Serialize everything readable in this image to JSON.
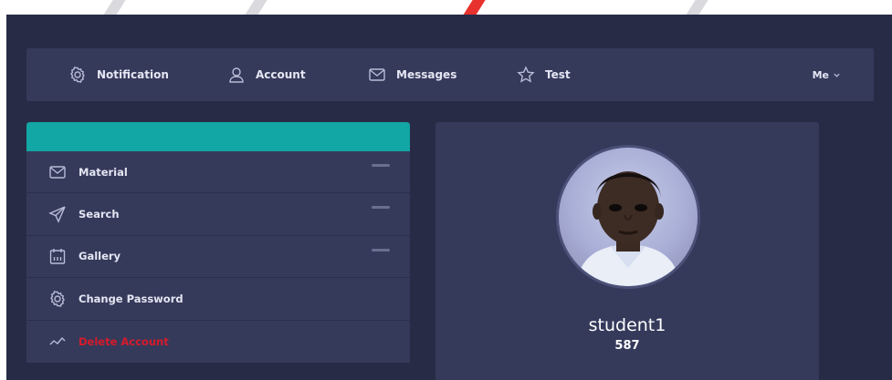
{
  "nav": {
    "items": [
      {
        "label": "Notification",
        "icon": "gear-icon"
      },
      {
        "label": "Account",
        "icon": "user-icon"
      },
      {
        "label": "Messages",
        "icon": "envelope-icon"
      },
      {
        "label": "Test",
        "icon": "star-icon"
      }
    ],
    "me_label": "Me"
  },
  "sidebar": {
    "items": [
      {
        "label": "Material",
        "icon": "envelope-icon"
      },
      {
        "label": "Search",
        "icon": "send-icon"
      },
      {
        "label": "Gallery",
        "icon": "calendar-icon"
      },
      {
        "label": "Change Password",
        "icon": "gear-icon"
      },
      {
        "label": "Delete Account",
        "icon": "chart-line-icon"
      }
    ]
  },
  "profile": {
    "username": "student1",
    "id": "587"
  },
  "colors": {
    "background": "#272b45",
    "panel": "#353a5b",
    "accent": "#12a6a4",
    "danger": "#d81a2a",
    "text": "#e4e6f2"
  }
}
